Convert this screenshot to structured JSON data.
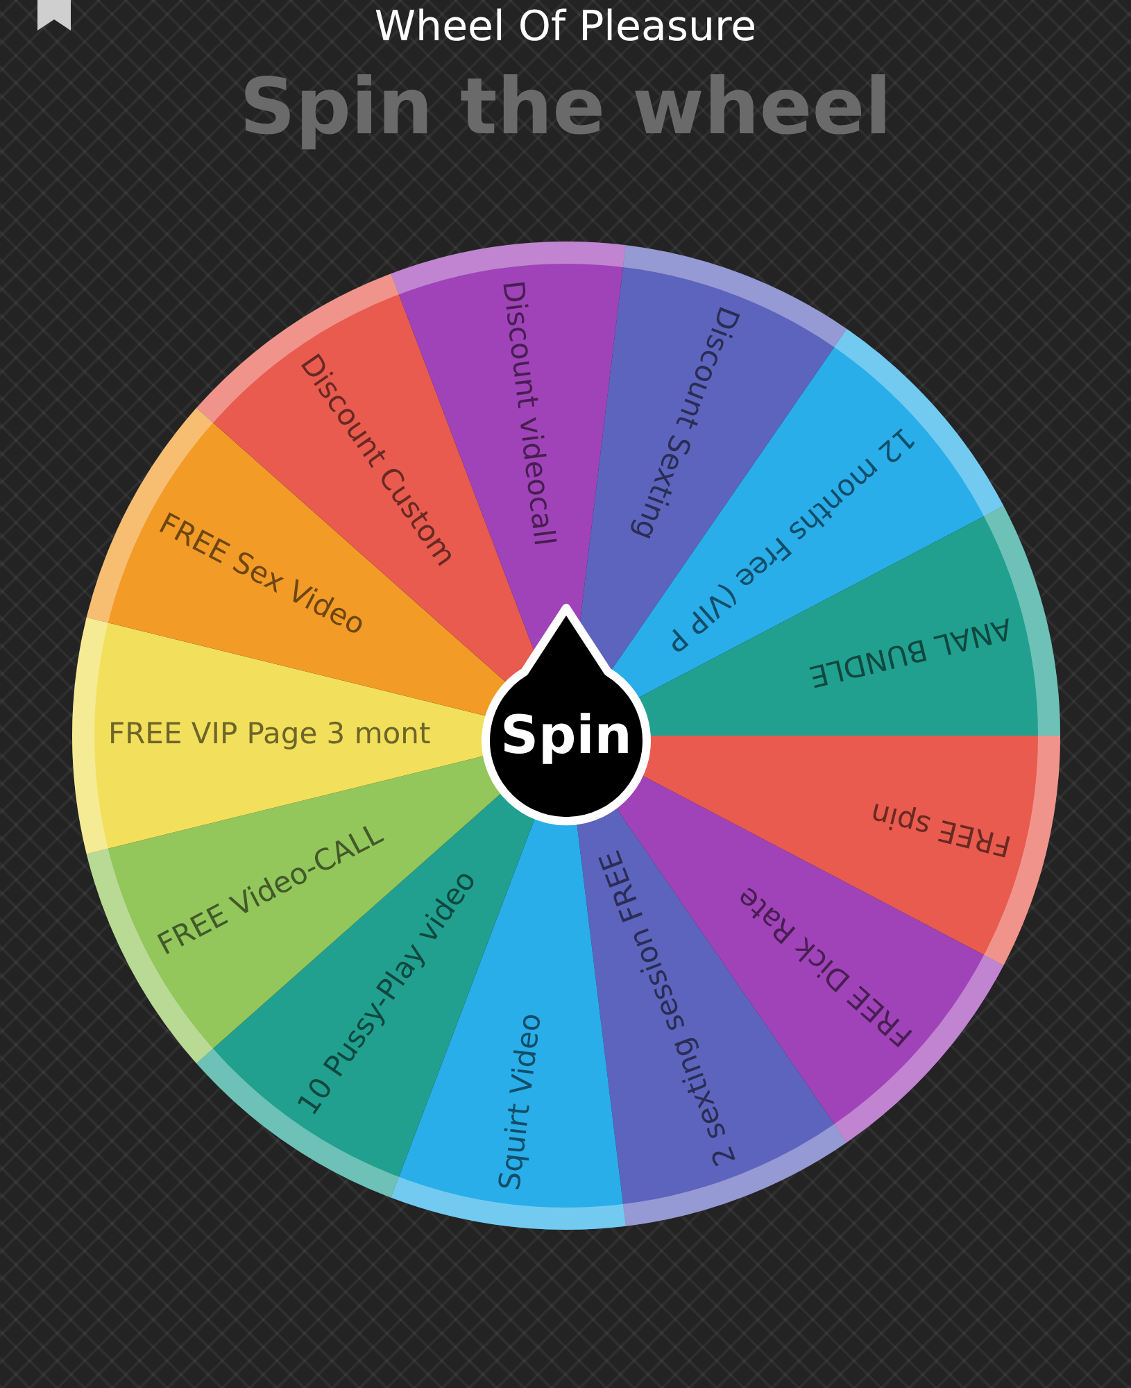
{
  "header": {
    "title": "Wheel Of Pleasure"
  },
  "heading": "Spin the wheel",
  "wheel": {
    "segments": [
      {
        "label": "FREE spin",
        "color": "#e85b4e"
      },
      {
        "label": "FREE Dick Rate",
        "color": "#a043b8"
      },
      {
        "label": "2 sexting session FREE",
        "color": "#5d64bd"
      },
      {
        "label": "Squirt Video",
        "color": "#29aee9"
      },
      {
        "label": "10 Pussy-Play video",
        "color": "#21a08f"
      },
      {
        "label": "FREE Video-CALL",
        "color": "#93c65b"
      },
      {
        "label": "FREE VIP Page 3 mont",
        "color": "#f2e05c"
      },
      {
        "label": "FREE Sex Video",
        "color": "#f39b27"
      },
      {
        "label": "Discount Custom",
        "color": "#e85b4e"
      },
      {
        "label": "Discount videocall",
        "color": "#a043b8"
      },
      {
        "label": "Discount Sexting",
        "color": "#5d64bd"
      },
      {
        "label": "12 months Free (VIP P",
        "color": "#29aee9"
      },
      {
        "label": "ANAL BUNDLE",
        "color": "#21a08f"
      }
    ],
    "spin_button": "Spin"
  }
}
